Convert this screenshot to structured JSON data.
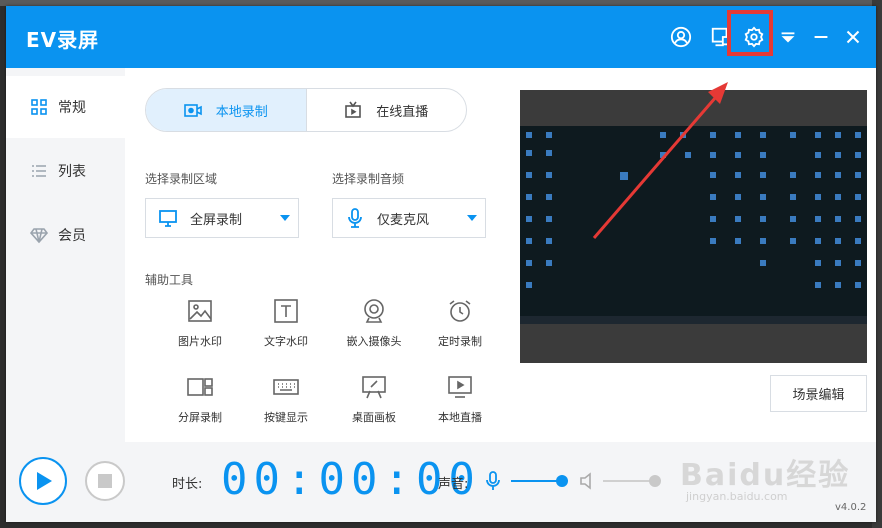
{
  "app": {
    "title": "EV录屏",
    "version": "v4.0.2",
    "accent_color": "#0a93f0",
    "highlight_color": "#e53935"
  },
  "titlebar_icons": [
    "user-icon",
    "monitor-icon",
    "settings-icon",
    "dropdown-icon",
    "minimize-icon",
    "close-icon"
  ],
  "sidebar": {
    "items": [
      {
        "label": "常规",
        "icon": "grid-icon",
        "active": true
      },
      {
        "label": "列表",
        "icon": "list-icon",
        "active": false
      },
      {
        "label": "会员",
        "icon": "diamond-icon",
        "active": false
      }
    ]
  },
  "mode_tabs": [
    {
      "label": "本地录制",
      "icon": "record-camera-icon",
      "active": true
    },
    {
      "label": "在线直播",
      "icon": "tv-icon",
      "active": false
    }
  ],
  "record_area": {
    "label": "选择录制区域",
    "value": "全屏录制",
    "icon": "monitor-icon"
  },
  "record_audio": {
    "label": "选择录制音频",
    "value": "仅麦克风",
    "icon": "microphone-icon"
  },
  "tools": {
    "label": "辅助工具",
    "items": [
      {
        "label": "图片水印",
        "icon": "image-icon"
      },
      {
        "label": "文字水印",
        "icon": "text-icon"
      },
      {
        "label": "嵌入摄像头",
        "icon": "webcam-icon"
      },
      {
        "label": "定时录制",
        "icon": "alarm-clock-icon"
      },
      {
        "label": "分屏录制",
        "icon": "split-screen-icon"
      },
      {
        "label": "按键显示",
        "icon": "keyboard-icon"
      },
      {
        "label": "桌面画板",
        "icon": "whiteboard-icon"
      },
      {
        "label": "本地直播",
        "icon": "local-live-icon"
      }
    ]
  },
  "scene_edit_label": "场景编辑",
  "bottom": {
    "duration_label": "时长:",
    "timer": "00:00:00",
    "sound_label": "声音:",
    "mic_level": 0.9,
    "speaker_level": 0.9
  },
  "watermark": {
    "text": "Baidu经验",
    "sub": "jingyan.baidu.com"
  }
}
